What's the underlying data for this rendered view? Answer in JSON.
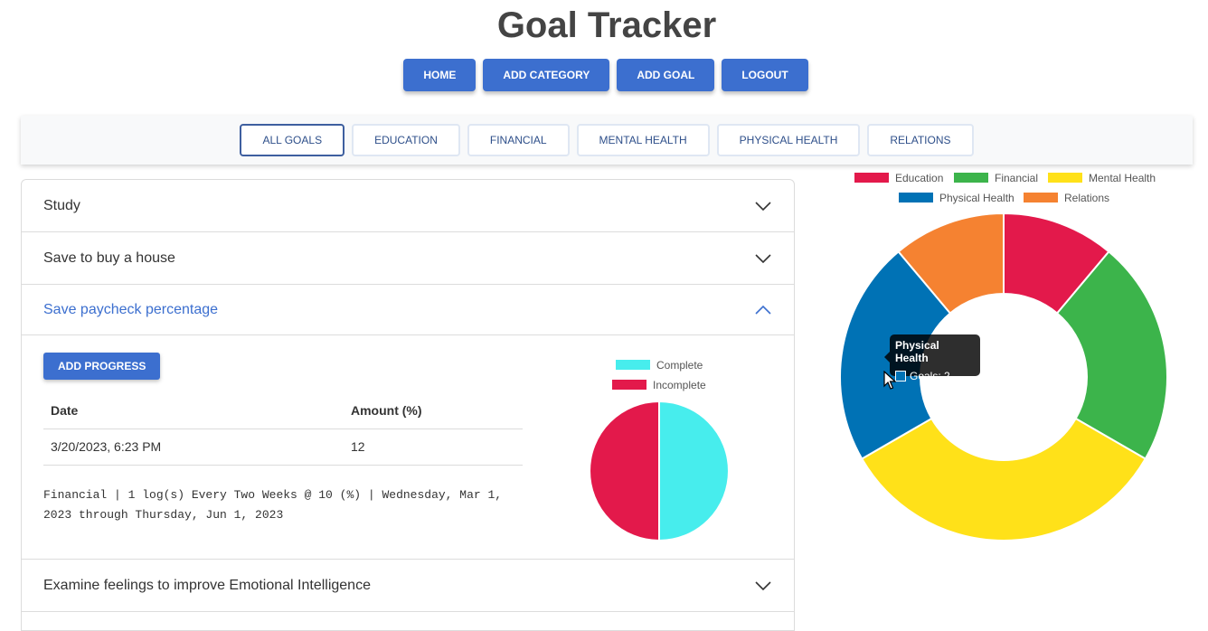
{
  "app": {
    "title": "Goal Tracker"
  },
  "nav": {
    "home": "HOME",
    "add_category": "ADD CATEGORY",
    "add_goal": "ADD GOAL",
    "logout": "LOGOUT"
  },
  "filters": [
    "ALL GOALS",
    "EDUCATION",
    "FINANCIAL",
    "MENTAL HEALTH",
    "PHYSICAL HEALTH",
    "RELATIONS"
  ],
  "active_filter": "ALL GOALS",
  "goals": [
    {
      "title": "Study",
      "expanded": false
    },
    {
      "title": "Save to buy a house",
      "expanded": false
    },
    {
      "title": "Save paycheck percentage",
      "expanded": true
    },
    {
      "title": "Examine feelings to improve Emotional Intelligence",
      "expanded": false
    }
  ],
  "expanded_goal": {
    "add_progress_label": "ADD PROGRESS",
    "table_headers": [
      "Date",
      "Amount (%)"
    ],
    "rows": [
      [
        "3/20/2023, 6:23 PM",
        "12"
      ]
    ],
    "description_line1": "Financial | 1 log(s) Every Two Weeks @ 10 (%) | Wednesday, Mar 1,",
    "description_line2": "2023 through Thursday, Jun 1, 2023"
  },
  "chart_data": [
    {
      "type": "pie",
      "categories": [
        "Complete",
        "Incomplete"
      ],
      "values": [
        1,
        1
      ],
      "colors": [
        "#47eded",
        "#e3194b"
      ],
      "title": "",
      "legend": "top"
    },
    {
      "type": "pie",
      "categories": [
        "Education",
        "Financial",
        "Mental Health",
        "Physical Health",
        "Relations"
      ],
      "values": [
        1,
        2,
        3,
        2,
        1
      ],
      "colors": [
        "#e3194b",
        "#3cb44b",
        "#ffe119",
        "#0072b5",
        "#f58231"
      ],
      "title": "",
      "legend": "top",
      "tooltip": {
        "title": "Physical Health",
        "label": "Goals: 2"
      }
    }
  ],
  "icons": {
    "collapsed": "chevron-down-icon",
    "expanded": "chevron-up-icon",
    "cursor": "mouse-cursor-icon"
  }
}
